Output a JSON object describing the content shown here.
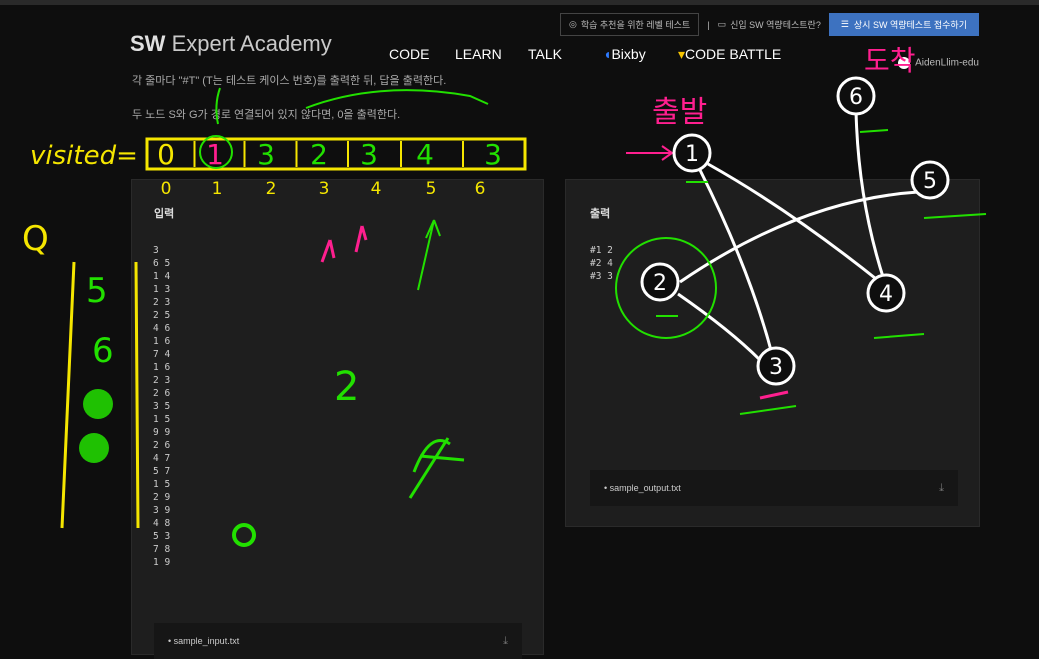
{
  "header": {
    "logo_bold": "SW",
    "logo_rest": " Expert Academy",
    "utility": {
      "level_test": "학습 추천을 위한 레벨 테스트",
      "separator": "|",
      "newbie_test": "신입 SW 역량테스트란?",
      "apply_button": "상시 SW 역량테스트 접수하기"
    },
    "nav": [
      "CODE",
      "LEARN",
      "TALK",
      "Bixby",
      "CODE BATTLE"
    ],
    "username": "AidenLlim-edu"
  },
  "problem": {
    "line1": "각 줄마다 \"#T\" (T는 테스트 케이스 번호)를 출력한 뒤, 답을 출력한다.",
    "line2": "두 노드 S와 G가 경로 연결되어 있지 않다면, 0을 출력한다."
  },
  "input_panel": {
    "title": "입력",
    "lines": [
      "3",
      "6 5",
      "1 4",
      "1 3",
      "2 3",
      "2 5",
      "4 6",
      "1 6",
      "7 4",
      "1 6",
      "2 3",
      "2 6",
      "3 5",
      "1 5",
      "9 9",
      "2 6",
      "4 7",
      "5 7",
      "1 5",
      "2 9",
      "3 9",
      "4 8",
      "5 3",
      "7 8",
      "1 9"
    ],
    "file": "sample_input.txt"
  },
  "output_panel": {
    "title": "출력",
    "lines": [
      "#1 2",
      "#2 4",
      "#3 3"
    ],
    "file": "sample_output.txt"
  },
  "annotations": {
    "visited_label": "visited=",
    "visited_values": [
      "0",
      "1",
      "3",
      "2",
      "3",
      "4",
      "3"
    ],
    "indices": [
      "0",
      "1",
      "2",
      "3",
      "4",
      "5",
      "6"
    ],
    "queue_label": "Q",
    "queue_items": [
      "5",
      "6"
    ],
    "start_label": "출발",
    "goal_label": "도착",
    "answer": "2",
    "graph_nodes": [
      "1",
      "2",
      "3",
      "4",
      "5",
      "6"
    ],
    "colors": {
      "green": "#22e000",
      "yellow": "#f5e600",
      "pink": "#ff1f8f",
      "white": "#ffffff"
    }
  }
}
